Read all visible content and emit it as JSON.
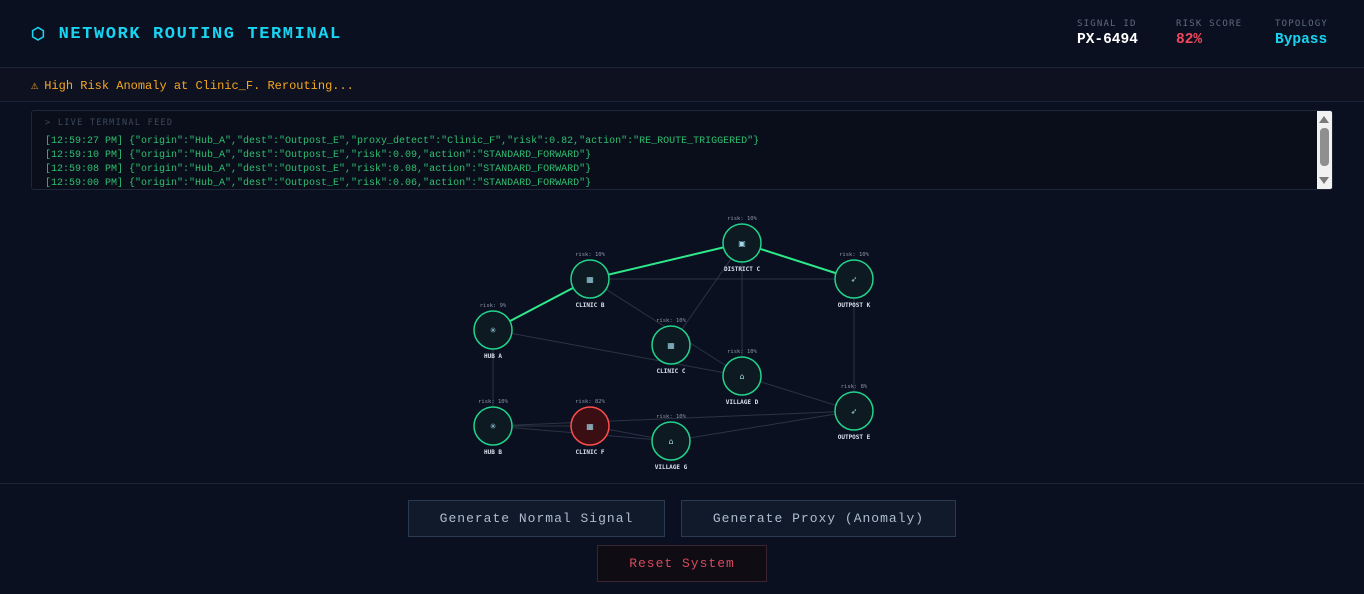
{
  "header": {
    "icon": "hexagon-icon",
    "icon_glyph": "⬡",
    "title": "NETWORK ROUTING TERMINAL",
    "stats": [
      {
        "label": "SIGNAL ID",
        "value": "PX-6494"
      },
      {
        "label": "RISK SCORE",
        "value": "82%"
      },
      {
        "label": "TOPOLOGY",
        "value": "Bypass"
      }
    ]
  },
  "alert": {
    "icon": "warning-icon",
    "icon_glyph": "⚠",
    "text": "High Risk Anomaly at Clinic_F. Rerouting..."
  },
  "terminal": {
    "title": "> LIVE TERMINAL FEED",
    "lines": [
      "[12:59:27 PM] {\"origin\":\"Hub_A\",\"dest\":\"Outpost_E\",\"proxy_detect\":\"Clinic_F\",\"risk\":0.82,\"action\":\"RE_ROUTE_TRIGGERED\"}",
      "[12:59:10 PM] {\"origin\":\"Hub_A\",\"dest\":\"Outpost_E\",\"risk\":0.09,\"action\":\"STANDARD_FORWARD\"}",
      "[12:59:08 PM] {\"origin\":\"Hub_A\",\"dest\":\"Outpost_E\",\"risk\":0.08,\"action\":\"STANDARD_FORWARD\"}",
      "[12:59:00 PM] {\"origin\":\"Hub_A\",\"dest\":\"Outpost_E\",\"risk\":0.06,\"action\":\"STANDARD_FORWARD\"}"
    ]
  },
  "graph": {
    "nodes": [
      {
        "id": "hub_a",
        "name": "HUB A",
        "risk_label": "risk: 9%",
        "icon": "hub-icon",
        "glyph": "✳",
        "status": "normal"
      },
      {
        "id": "clinic_b",
        "name": "CLINIC B",
        "risk_label": "risk: 10%",
        "icon": "clinic-icon",
        "glyph": "▦",
        "status": "normal"
      },
      {
        "id": "district_c",
        "name": "DISTRICT C",
        "risk_label": "risk: 10%",
        "icon": "district-icon",
        "glyph": "▣",
        "status": "normal"
      },
      {
        "id": "outpost_k",
        "name": "OUTPOST K",
        "risk_label": "risk: 10%",
        "icon": "outpost-icon",
        "glyph": "➶",
        "status": "normal"
      },
      {
        "id": "clinic_c",
        "name": "CLINIC C",
        "risk_label": "risk: 10%",
        "icon": "clinic-icon",
        "glyph": "▦",
        "status": "normal"
      },
      {
        "id": "village_d",
        "name": "VILLAGE D",
        "risk_label": "risk: 10%",
        "icon": "village-icon",
        "glyph": "⌂",
        "status": "normal"
      },
      {
        "id": "outpost_e",
        "name": "OUTPOST E",
        "risk_label": "risk: 8%",
        "icon": "outpost-icon",
        "glyph": "➶",
        "status": "normal"
      },
      {
        "id": "hub_b",
        "name": "HUB B",
        "risk_label": "risk: 10%",
        "icon": "hub-icon",
        "glyph": "✳",
        "status": "normal"
      },
      {
        "id": "clinic_f",
        "name": "CLINIC F",
        "risk_label": "risk: 82%",
        "icon": "clinic-icon",
        "glyph": "▦",
        "status": "anomaly"
      },
      {
        "id": "village_g",
        "name": "VILLAGE G",
        "risk_label": "risk: 10%",
        "icon": "village-icon",
        "glyph": "⌂",
        "status": "normal"
      }
    ],
    "edges": [
      {
        "from": "hub_a",
        "to": "clinic_b",
        "active": true
      },
      {
        "from": "clinic_b",
        "to": "district_c",
        "active": true
      },
      {
        "from": "district_c",
        "to": "outpost_k",
        "active": true
      },
      {
        "from": "clinic_b",
        "to": "outpost_k",
        "active": false
      },
      {
        "from": "clinic_b",
        "to": "village_d",
        "active": false
      },
      {
        "from": "district_c",
        "to": "clinic_c",
        "active": false
      },
      {
        "from": "district_c",
        "to": "village_d",
        "active": false
      },
      {
        "from": "hub_a",
        "to": "village_d",
        "active": false
      },
      {
        "from": "hub_a",
        "to": "hub_b",
        "active": false
      },
      {
        "from": "outpost_k",
        "to": "outpost_e",
        "active": false
      },
      {
        "from": "village_d",
        "to": "outpost_e",
        "active": false
      },
      {
        "from": "hub_b",
        "to": "clinic_f",
        "active": false
      },
      {
        "from": "hub_b",
        "to": "village_g",
        "active": false
      },
      {
        "from": "clinic_f",
        "to": "village_g",
        "active": false
      },
      {
        "from": "hub_b",
        "to": "outpost_e",
        "active": false
      },
      {
        "from": "village_g",
        "to": "outpost_e",
        "active": false
      }
    ],
    "colors": {
      "active_edge": "#2ee88a",
      "edge": "#2a3444",
      "node_ring": "#22d48a",
      "anomaly_ring": "#ff4d4d",
      "anomaly_fill": "#3a0e12",
      "node_fill": "#0d1a22"
    }
  },
  "actions": {
    "normal_label": "Generate Normal Signal",
    "proxy_label": "Generate Proxy (Anomaly)",
    "reset_label": "Reset System"
  }
}
